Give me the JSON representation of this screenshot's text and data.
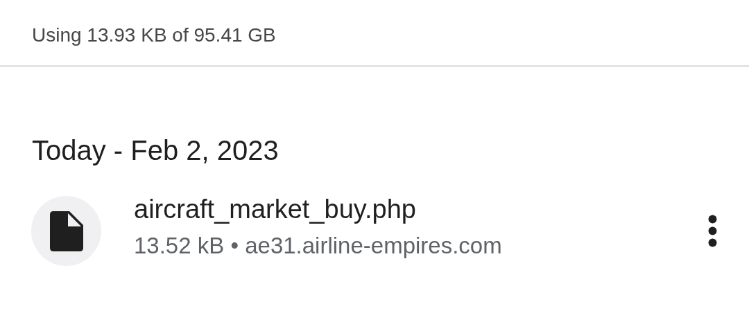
{
  "storage_summary": "Using 13.93 KB of 95.41 GB",
  "sections": [
    {
      "title": "Today - Feb 2, 2023",
      "items": [
        {
          "name": "aircraft_market_buy.php",
          "size": "13.52 kB",
          "separator": "•",
          "source": "ae31.airline-empires.com"
        }
      ]
    }
  ]
}
